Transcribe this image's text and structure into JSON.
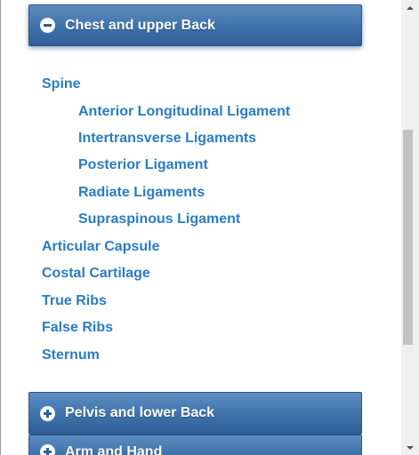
{
  "panels": [
    {
      "title": "Chest and upper Back",
      "state": "expanded",
      "icon": "minus-circle-icon"
    },
    {
      "title": "Pelvis and lower Back",
      "state": "collapsed",
      "icon": "plus-circle-icon"
    },
    {
      "title": "Arm and Hand",
      "state": "collapsed",
      "icon": "plus-circle-icon"
    }
  ],
  "items": {
    "spine": "Spine",
    "anterior": "Anterior Longitudinal Ligament",
    "intertransverse": "Intertransverse Ligaments",
    "posterior": "Posterior Ligament",
    "radiate": "Radiate Ligaments",
    "supraspinous": "Supraspinous Ligament",
    "articular": "Articular Capsule",
    "costal": "Costal Cartilage",
    "true_ribs": "True Ribs",
    "false_ribs": "False Ribs",
    "sternum": "Sternum"
  },
  "colors": {
    "header_blue": "#3f72aa",
    "link_blue": "#2a7cc4",
    "header_text": "#ffffff"
  }
}
